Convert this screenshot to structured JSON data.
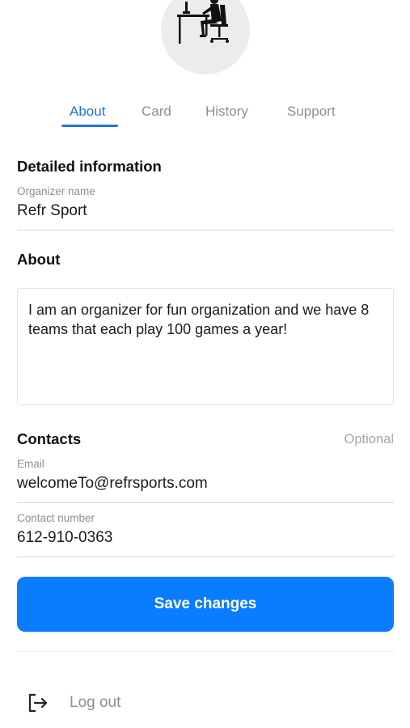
{
  "profile": {
    "avatar_icon": "person-at-desk-icon"
  },
  "tabs": [
    {
      "label": "About",
      "active": true
    },
    {
      "label": "Card",
      "active": false
    },
    {
      "label": "History",
      "active": false
    },
    {
      "label": "Support",
      "active": false
    }
  ],
  "detailed_information": {
    "title": "Detailed information",
    "organizer_name_label": "Organizer name",
    "organizer_name_value": "Refr Sport"
  },
  "about": {
    "title": "About",
    "text": "I am an organizer for fun organization and we have 8 teams that each play 100 games a year!"
  },
  "contacts": {
    "title": "Contacts",
    "optional_label": "Optional",
    "email_label": "Email",
    "email_value": "welcomeTo@refrsports.com",
    "phone_label": "Contact number",
    "phone_value": "612-910-0363"
  },
  "actions": {
    "save_label": "Save changes",
    "logout_label": "Log out"
  },
  "colors": {
    "accent": "#1e78d6",
    "button": "#0a7cff"
  }
}
